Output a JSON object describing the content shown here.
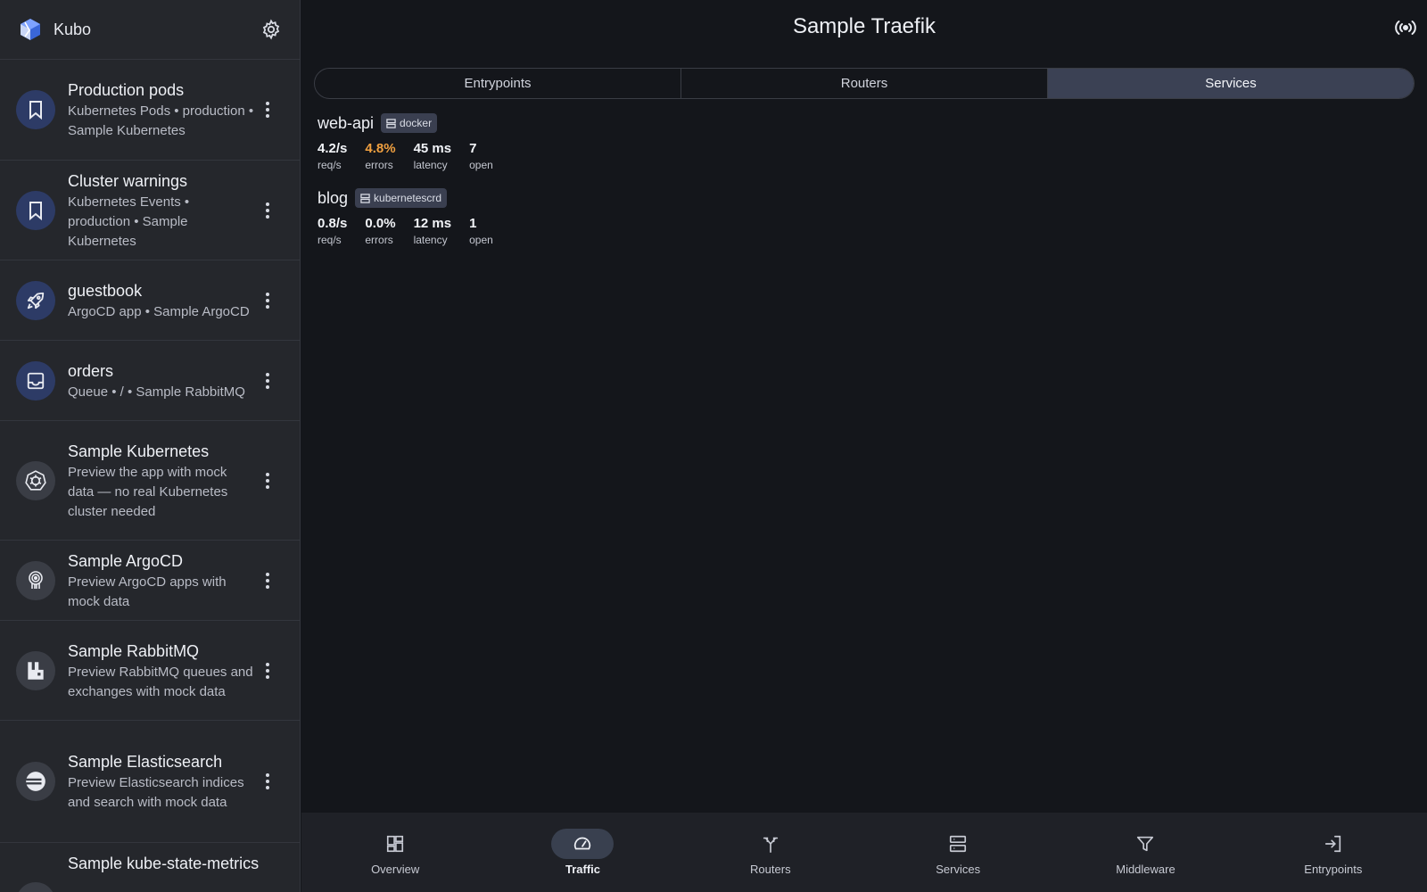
{
  "app": {
    "name": "Kubo"
  },
  "sidebar": {
    "items": [
      {
        "title": "Production pods",
        "subtitle": "Kubernetes Pods • production • Sample Kubernetes",
        "icon": "bookmark-icon"
      },
      {
        "title": "Cluster warnings",
        "subtitle": "Kubernetes Events • production • Sample Kubernetes",
        "icon": "bookmark-icon"
      },
      {
        "title": "guestbook",
        "subtitle": "ArgoCD app • Sample ArgoCD",
        "icon": "rocket-icon"
      },
      {
        "title": "orders",
        "subtitle": "Queue • / • Sample RabbitMQ",
        "icon": "inbox-icon"
      },
      {
        "title": "Sample Kubernetes",
        "subtitle": "Preview the app with mock data — no real Kubernetes cluster needed",
        "icon": "kubernetes-icon"
      },
      {
        "title": "Sample ArgoCD",
        "subtitle": "Preview ArgoCD apps with mock data",
        "icon": "argocd-icon"
      },
      {
        "title": "Sample RabbitMQ",
        "subtitle": "Preview RabbitMQ queues and exchanges with mock data",
        "icon": "rabbitmq-icon"
      },
      {
        "title": "Sample Elasticsearch",
        "subtitle": "Preview Elasticsearch indices and search with mock data",
        "icon": "elasticsearch-icon"
      },
      {
        "title": "Sample kube-state-metrics",
        "subtitle": "",
        "icon": "metrics-icon"
      }
    ]
  },
  "main": {
    "title": "Sample Traefik",
    "tabs": [
      {
        "label": "Entrypoints",
        "active": false
      },
      {
        "label": "Routers",
        "active": false
      },
      {
        "label": "Services",
        "active": true
      }
    ],
    "services": [
      {
        "name": "web-api",
        "provider": "docker",
        "metrics": [
          {
            "value": "4.2/s",
            "label": "req/s"
          },
          {
            "value": "4.8%",
            "label": "errors",
            "warn": true
          },
          {
            "value": "45 ms",
            "label": "latency"
          },
          {
            "value": "7",
            "label": "open"
          }
        ]
      },
      {
        "name": "blog",
        "provider": "kubernetescrd",
        "metrics": [
          {
            "value": "0.8/s",
            "label": "req/s"
          },
          {
            "value": "0.0%",
            "label": "errors"
          },
          {
            "value": "12 ms",
            "label": "latency"
          },
          {
            "value": "1",
            "label": "open"
          }
        ]
      }
    ]
  },
  "bottom_nav": [
    {
      "label": "Overview",
      "icon": "dashboard-icon",
      "active": false
    },
    {
      "label": "Traffic",
      "icon": "speedometer-icon",
      "active": true
    },
    {
      "label": "Routers",
      "icon": "fork-icon",
      "active": false
    },
    {
      "label": "Services",
      "icon": "server-icon",
      "active": false
    },
    {
      "label": "Middleware",
      "icon": "filter-icon",
      "active": false
    },
    {
      "label": "Entrypoints",
      "icon": "login-icon",
      "active": false
    }
  ],
  "colors": {
    "accent": "#3b4154",
    "warning": "#f0a040",
    "avatar_blue": "#2d3b66"
  }
}
